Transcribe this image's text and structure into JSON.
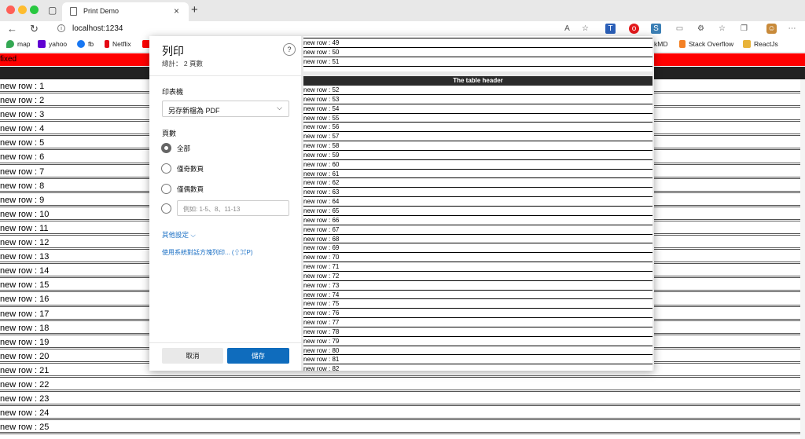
{
  "browser": {
    "tab_title": "Print Demo",
    "url": "localhost:1234",
    "bookmarks": [
      {
        "label": "map",
        "color": "#34a853"
      },
      {
        "label": "yahoo",
        "color": "#6001d2"
      },
      {
        "label": "fb",
        "color": "#1877f2"
      },
      {
        "label": "Netflix",
        "color": "#e50914"
      }
    ],
    "bookmarks_right": [
      {
        "label": "kMD",
        "color": "#333333"
      },
      {
        "label": "Stack Overflow",
        "color": "#f48024"
      },
      {
        "label": "ReactJs",
        "color": "#e8b33a"
      }
    ]
  },
  "page": {
    "fixed_label": "fixed",
    "rows": [
      "new row : 1",
      "new row : 2",
      "new row : 3",
      "new row : 4",
      "new row : 5",
      "new row : 6",
      "new row : 7",
      "new row : 8",
      "new row : 9",
      "new row : 10",
      "new row : 11",
      "new row : 12",
      "new row : 13",
      "new row : 14",
      "new row : 15",
      "new row : 16",
      "new row : 17",
      "new row : 18",
      "new row : 19",
      "new row : 20",
      "new row : 21",
      "new row : 22",
      "new row : 23",
      "new row : 24",
      "new row : 25"
    ]
  },
  "print_dialog": {
    "title": "列印",
    "total": "總計： 2 頁數",
    "help": "?",
    "printer_label": "印表機",
    "printer_value": "另存新檔為 PDF",
    "pages_label": "頁數",
    "page_options": [
      "全部",
      "僅奇數頁",
      "僅偶數頁"
    ],
    "custom_placeholder": "例如: 1-5、8、11-13",
    "more_settings": "其他設定 ⌵",
    "system_dialog": "使用系統對話方塊列印... (⇧⌘P)",
    "cancel": "取消",
    "save": "儲存"
  },
  "preview": {
    "page1_rows": [
      "new row : 49",
      "new row : 50",
      "new row : 51"
    ],
    "table_header": "The table header",
    "page2_rows": [
      "new row : 52",
      "new row : 53",
      "new row : 54",
      "new row : 55",
      "new row : 56",
      "new row : 57",
      "new row : 58",
      "new row : 59",
      "new row : 60",
      "new row : 61",
      "new row : 62",
      "new row : 63",
      "new row : 64",
      "new row : 65",
      "new row : 66",
      "new row : 67",
      "new row : 68",
      "new row : 69",
      "new row : 70",
      "new row : 71",
      "new row : 72",
      "new row : 73",
      "new row : 74",
      "new row : 75",
      "new row : 76",
      "new row : 77",
      "new row : 78",
      "new row : 79",
      "new row : 80",
      "new row : 81",
      "new row : 82"
    ]
  }
}
